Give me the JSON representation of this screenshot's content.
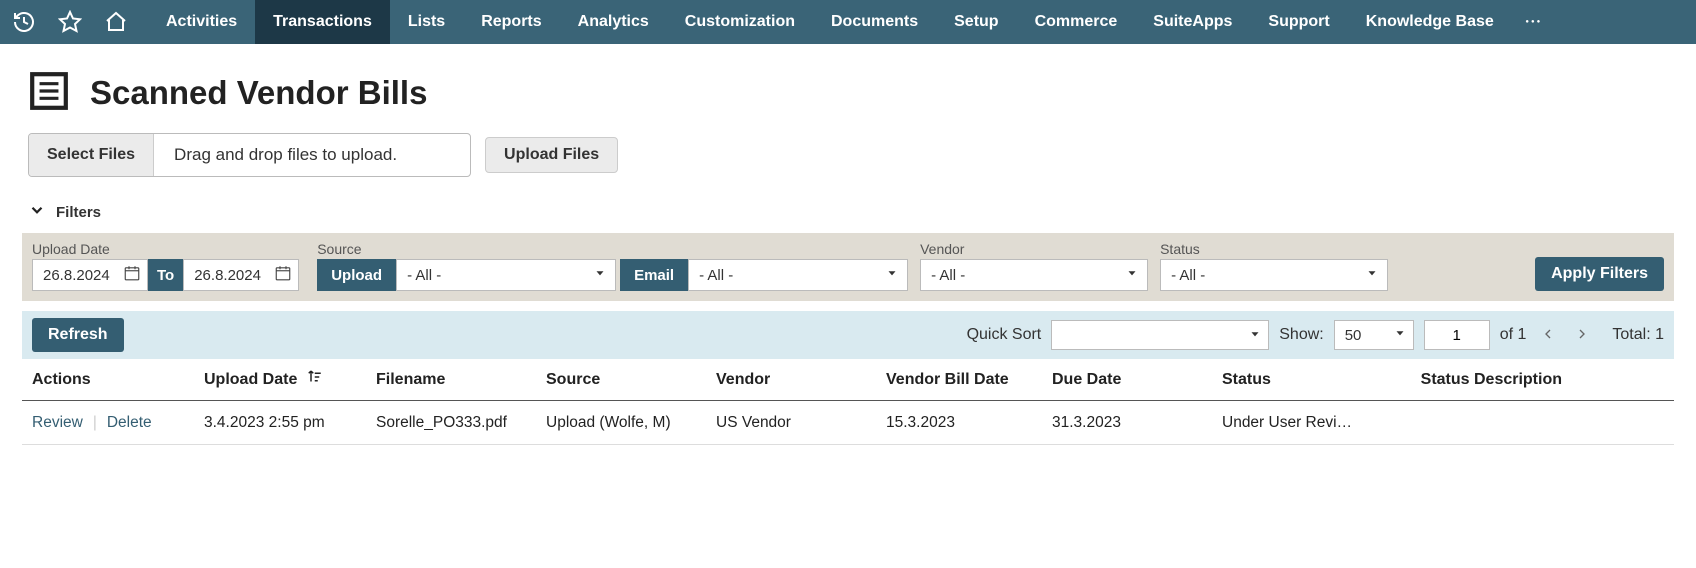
{
  "nav": {
    "items": [
      "Activities",
      "Transactions",
      "Lists",
      "Reports",
      "Analytics",
      "Customization",
      "Documents",
      "Setup",
      "Commerce",
      "SuiteApps",
      "Support",
      "Knowledge Base"
    ],
    "active_index": 1
  },
  "page": {
    "title": "Scanned Vendor Bills"
  },
  "upload": {
    "select_label": "Select Files",
    "drop_label": "Drag and drop files to upload.",
    "upload_label": "Upload Files"
  },
  "filters": {
    "header": "Filters",
    "upload_date_label": "Upload Date",
    "from_date": "26.8.2024",
    "to_label": "To",
    "to_date": "26.8.2024",
    "source_label": "Source",
    "upload_chip": "Upload",
    "source_value": "- All -",
    "email_chip": "Email",
    "email_value": "- All -",
    "vendor_label": "Vendor",
    "vendor_value": "- All -",
    "status_label": "Status",
    "status_value": "- All -",
    "apply_label": "Apply Filters"
  },
  "toolbar": {
    "refresh_label": "Refresh",
    "quicksort_label": "Quick Sort",
    "show_label": "Show:",
    "show_value": "50",
    "page_value": "1",
    "of_label": "of 1",
    "total_label": "Total: 1"
  },
  "table": {
    "headers": {
      "actions": "Actions",
      "upload_date": "Upload Date",
      "filename": "Filename",
      "source": "Source",
      "vendor": "Vendor",
      "bill_date": "Vendor Bill Date",
      "due_date": "Due Date",
      "status": "Status",
      "status_desc": "Status Description"
    },
    "rows": [
      {
        "review": "Review",
        "delete": "Delete",
        "upload_date": "3.4.2023 2:55 pm",
        "filename": "Sorelle_PO333.pdf",
        "source": "Upload (Wolfe, M)",
        "vendor": "US Vendor",
        "bill_date": "15.3.2023",
        "due_date": "31.3.2023",
        "status": "Under User Revi…",
        "status_desc": ""
      }
    ]
  }
}
